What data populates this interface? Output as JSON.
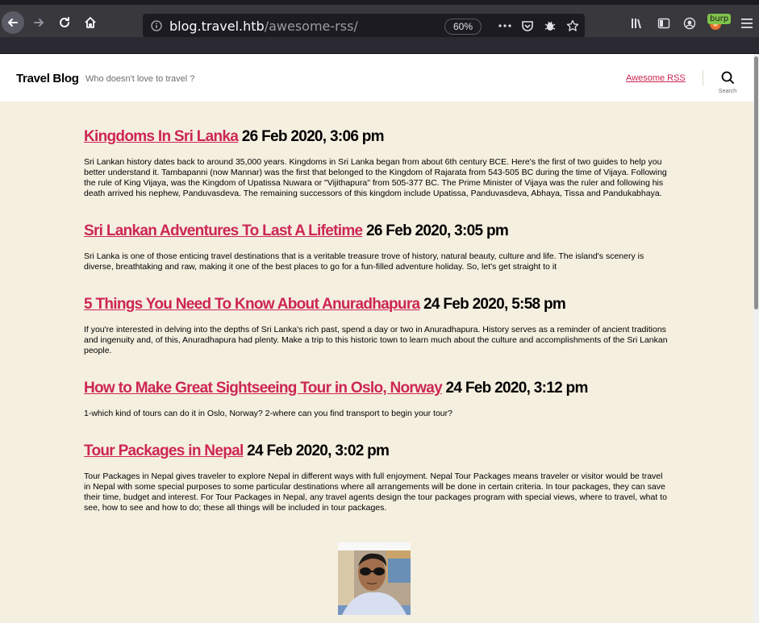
{
  "browser": {
    "url_host": "blog.travel.htb",
    "url_path": "/awesome-rss/",
    "zoom": "60%",
    "burp_badge": "burp"
  },
  "site": {
    "title": "Travel Blog",
    "tagline": "Who doesn't love to travel ?",
    "menu_link": "Awesome RSS",
    "search_label": "Search"
  },
  "posts": [
    {
      "title": "Kingdoms In Sri Lanka",
      "date": "26 Feb 2020, 3:06 pm",
      "excerpt": "Sri Lankan history dates back to around 35,000 years. Kingdoms in Sri Lanka began from about 6th century BCE. Here's the first of two guides to help you better understand it. Tambapanni (now Mannar) was the first that belonged to the Kingdom of Rajarata from 543-505 BC during the time of Vijaya. Following the rule of King Vijaya, was the Kingdom of Upatissa Nuwara or \"Vijithapura\" from 505-377 BC. The Prime Minister of Vijaya was the ruler and following his death arrived his nephew, Panduvasdeva. The remaining successors of this kingdom include Upatissa, Panduvasdeva, Abhaya, Tissa and Pandukabhaya."
    },
    {
      "title": "Sri Lankan Adventures To Last A Lifetime",
      "date": "26 Feb 2020, 3:05 pm",
      "excerpt": "Sri Lanka is one of those enticing travel destinations that is a veritable treasure trove of history, natural beauty, culture and life. The island's scenery is diverse, breathtaking and raw, making it one of the best places to go for a fun-filled adventure holiday. So, let's get straight to it"
    },
    {
      "title": "5 Things You Need To Know About Anuradhapura",
      "date": "24 Feb 2020, 5:58 pm",
      "excerpt": "If you're interested in delving into the depths of Sri Lanka's rich past, spend a day or two in Anuradhapura. History serves as a reminder of ancient traditions and ingenuity and, of this, Anuradhapura had plenty. Make a trip to this historic town to learn much about the culture and accomplishments of the Sri Lankan people."
    },
    {
      "title": "How to Make Great Sightseeing Tour in Oslo, Norway",
      "date": "24 Feb 2020, 3:12 pm",
      "excerpt": "1-which kind of tours can do it in Oslo, Norway? 2-where can you find transport to begin your tour?"
    },
    {
      "title": "Tour Packages in Nepal",
      "date": "24 Feb 2020, 3:02 pm",
      "excerpt": "Tour Packages in Nepal gives traveler to explore Nepal in different ways with full enjoyment. Nepal Tour Packages means traveler or visitor would be travel in Nepal with some special purposes to some particular destinations where all arrangements will be done in certain criteria. In tour packages, they can save their time, budget and interest. For Tour Packages in Nepal, any travel agents design the tour packages program with special views, where to travel, what to see, how to see and how to do; these all things will be included in tour packages."
    }
  ]
}
